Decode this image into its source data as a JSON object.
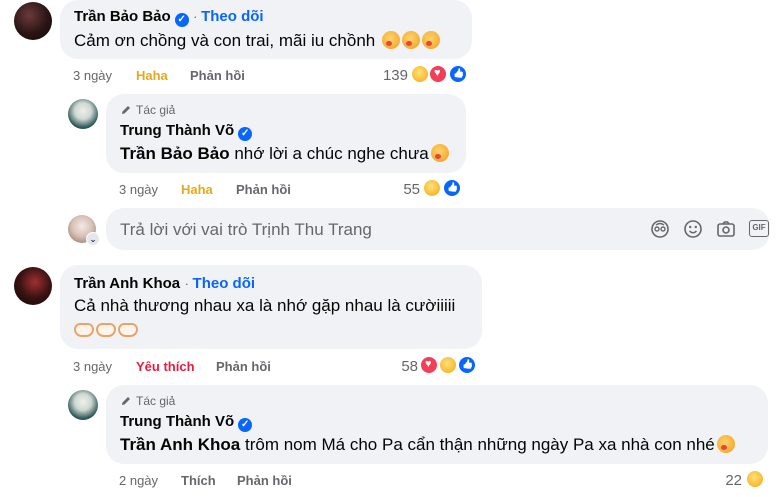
{
  "comments": [
    {
      "author": "Trần Bảo Bảo",
      "follow": "Theo dõi",
      "text": "Cảm ơn chồng và con trai, mãi iu chồnh",
      "time": "3 ngày",
      "reaction_label": "Haha",
      "reply_label": "Phản hồi",
      "reaction_count": "139",
      "reply": {
        "tag": "Tác giả",
        "author": "Trung Thành Võ",
        "mention": "Trần Bảo Bảo",
        "text": "nhớ lời a chúc nghe chưa",
        "time": "3 ngày",
        "reaction_label": "Haha",
        "reply_label": "Phản hồi",
        "reaction_count": "55"
      }
    },
    {
      "author": "Trần Anh Khoa",
      "follow": "Theo dõi",
      "text": "Cả nhà thương nhau xa là nhớ gặp nhau là cườiiiii",
      "time": "3 ngày",
      "reaction_label": "Yêu thích",
      "reply_label": "Phản hồi",
      "reaction_count": "58",
      "reply": {
        "tag": "Tác giả",
        "author": "Trung Thành Võ",
        "mention": "Trần Anh Khoa",
        "text": "trôm nom Má cho Pa cẩn thận những ngày Pa xa nhà con nhé",
        "time": "2 ngày",
        "reaction_label": "Thích",
        "reply_label": "Phản hồi",
        "reaction_count": "22"
      }
    }
  ],
  "composer": {
    "placeholder": "Trả lời với vai trò Trịnh Thu Trang",
    "icons": [
      "avatar-sticker-icon",
      "emoji-icon",
      "camera-icon",
      "gif-icon"
    ],
    "gif_label": "GIF"
  },
  "colors": {
    "link": "#0866ff",
    "haha": "#e6a81d",
    "love": "#e41e3f",
    "bubble": "#f0f2f5",
    "muted": "#65676b"
  }
}
